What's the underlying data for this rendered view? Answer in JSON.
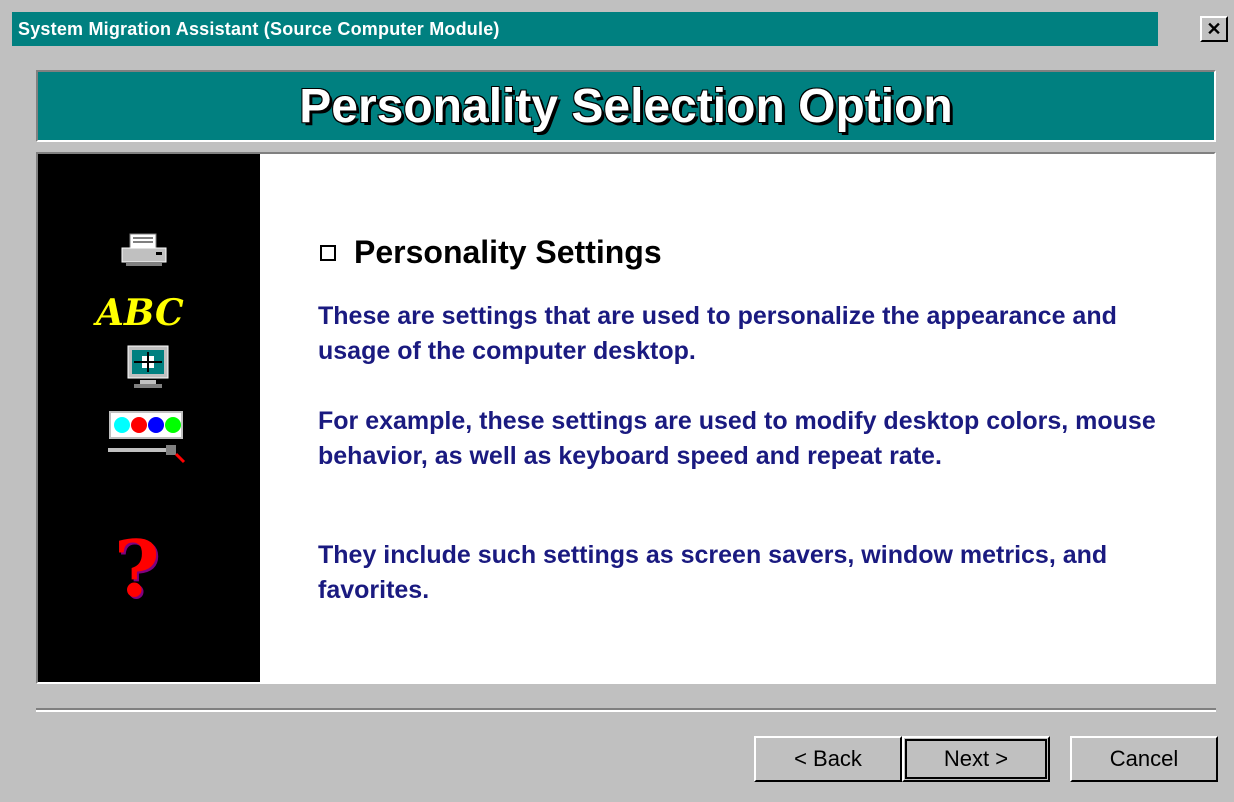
{
  "window": {
    "title": "System Migration Assistant (Source Computer Module)",
    "close_glyph": "✕"
  },
  "header": {
    "title": "Personality Selection Option"
  },
  "sidebar": {
    "icons": [
      "printer-icon",
      "abc-icon",
      "monitor-icon",
      "palette-icon",
      "help-icon"
    ],
    "abc_text": "ABC",
    "help_text": "?"
  },
  "main": {
    "option_label": "Personality Settings",
    "option_checked": false,
    "paragraphs": [
      "These are settings that are used to personalize the appearance and usage of the computer desktop.",
      "For example, these settings are used to modify desktop colors, mouse behavior, as well as keyboard speed and repeat rate.",
      "They include such settings as screen savers, window metrics, and favorites."
    ]
  },
  "buttons": {
    "back": "< Back",
    "next": "Next >",
    "cancel": "Cancel"
  },
  "colors": {
    "titlebar": "#008080",
    "face": "#c0c0c0",
    "text_blue": "#1a1a80",
    "sidebar": "#000000"
  }
}
